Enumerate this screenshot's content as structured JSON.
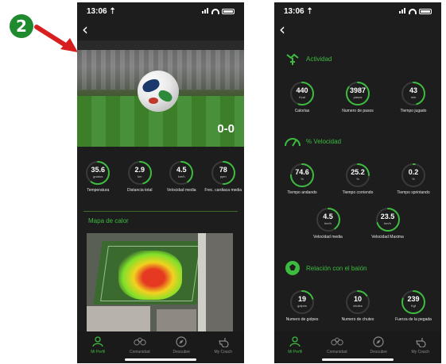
{
  "step_badge": "2",
  "colors": {
    "accent": "#3dbb3f",
    "background": "#1d1d1d",
    "arrow": "#d71f1f"
  },
  "left_screen": {
    "status_time": "13:06 ⇡",
    "score": "0-0",
    "stats": [
      {
        "value": "35.6",
        "unit": "grados",
        "label": "Temperatura",
        "progress": 0.6
      },
      {
        "value": "2.9",
        "unit": "km",
        "label": "Distancia total",
        "progress": 0.45
      },
      {
        "value": "4.5",
        "unit": "km/h",
        "label": "Velocidad media",
        "progress": 0.4
      },
      {
        "value": "78",
        "unit": "ppm",
        "label": "Frec. cardiaca media",
        "progress": 0.5
      }
    ],
    "heatmap_title": "Mapa de calor"
  },
  "right_screen": {
    "status_time": "13:06 ⇡",
    "sections": [
      {
        "title": "Actividad",
        "icon": "activity-icon",
        "stats": [
          {
            "value": "440",
            "unit": "Kcal",
            "label": "Calorías",
            "progress": 0.55
          },
          {
            "value": "3987",
            "unit": "pasos",
            "label": "Numero de pasos",
            "progress": 0.85
          },
          {
            "value": "43",
            "unit": "min",
            "label": "Tiempo jugado",
            "progress": 0.45
          }
        ]
      },
      {
        "title": "% Velocidad",
        "icon": "speedometer-icon",
        "stats": [
          {
            "value": "74.6",
            "unit": "%",
            "label": "Tiempo andando",
            "progress": 0.75
          },
          {
            "value": "25.2",
            "unit": "%",
            "label": "Tiempo corriendo",
            "progress": 0.25
          },
          {
            "value": "0.2",
            "unit": "%",
            "label": "Tiempo sprintando",
            "progress": 0.02
          },
          {
            "value": "4.5",
            "unit": "km/h",
            "label": "Velocidad media",
            "progress": 0.4
          },
          {
            "value": "23.5",
            "unit": "km/h",
            "label": "Velocidad Maxima",
            "progress": 0.7
          }
        ]
      },
      {
        "title": "Relación con el balón",
        "icon": "ball-icon",
        "stats": [
          {
            "value": "19",
            "unit": "golpes",
            "label": "Numero de golpes",
            "progress": 0.2
          },
          {
            "value": "10",
            "unit": "chutes",
            "label": "Numero de chutes",
            "progress": 0.15
          },
          {
            "value": "239",
            "unit": "Kgf",
            "label": "Fuerza de la pegada",
            "progress": 0.8
          }
        ]
      }
    ]
  },
  "tabbar": [
    {
      "label": "Mi Perfil",
      "icon": "profile-icon",
      "active": true
    },
    {
      "label": "Comunidad",
      "icon": "community-icon",
      "active": false
    },
    {
      "label": "Descubre",
      "icon": "compass-icon",
      "active": false
    },
    {
      "label": "My Coach",
      "icon": "whistle-icon",
      "active": false
    }
  ]
}
